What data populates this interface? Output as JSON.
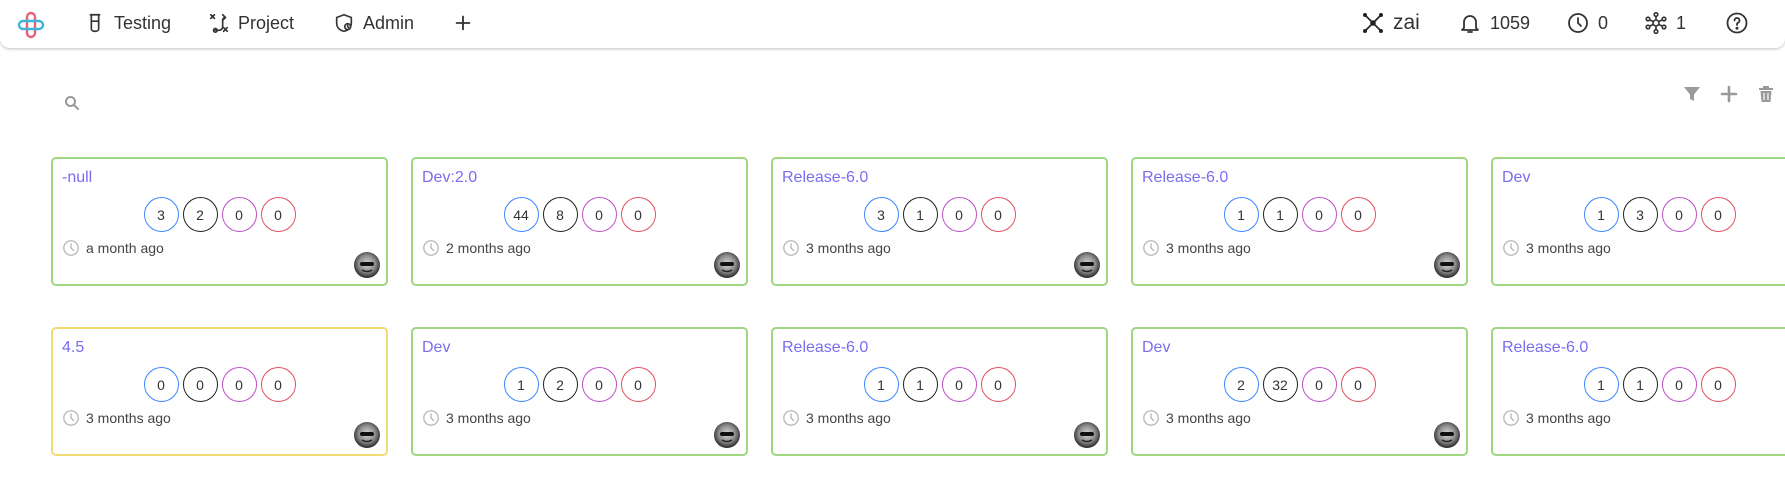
{
  "nav": {
    "testing": "Testing",
    "project": "Project",
    "admin": "Admin"
  },
  "status": {
    "user": "zai",
    "notifications": "1059",
    "pending": "0",
    "network": "1"
  },
  "colors": {
    "accent": "#7b6cf0",
    "card_border_green": "#9fd67f",
    "card_border_yellow": "#f0dc73",
    "count_blue": "#3a86ff",
    "count_dark": "#222222",
    "count_purple": "#c050c8",
    "count_red": "#e05060"
  },
  "icons": {
    "logo": "app-logo-icon",
    "testing": "flask-icon",
    "project": "route-icon",
    "admin": "shield-icon",
    "add": "plus-icon",
    "user": "network-node-icon",
    "notifications": "bell-icon",
    "pending": "clock-icon",
    "network": "hub-icon",
    "help": "help-icon",
    "search": "search-icon",
    "filter": "filter-icon",
    "tool_add": "plus-icon",
    "delete": "trash-icon"
  },
  "cards": [
    {
      "title": "-null",
      "counts": [
        "3",
        "2",
        "0",
        "0"
      ],
      "time": "a month ago",
      "border": "green"
    },
    {
      "title": "Dev:2.0",
      "counts": [
        "44",
        "8",
        "0",
        "0"
      ],
      "time": "2 months ago",
      "border": "green"
    },
    {
      "title": "Release-6.0",
      "counts": [
        "3",
        "1",
        "0",
        "0"
      ],
      "time": "3 months ago",
      "border": "green"
    },
    {
      "title": "Release-6.0",
      "counts": [
        "1",
        "1",
        "0",
        "0"
      ],
      "time": "3 months ago",
      "border": "green"
    },
    {
      "title": "Dev",
      "counts": [
        "1",
        "3",
        "0",
        "0"
      ],
      "time": "3 months ago",
      "border": "green"
    },
    {
      "title": "4.5",
      "counts": [
        "0",
        "0",
        "0",
        "0"
      ],
      "time": "3 months ago",
      "border": "yellow"
    },
    {
      "title": "Dev",
      "counts": [
        "1",
        "2",
        "0",
        "0"
      ],
      "time": "3 months ago",
      "border": "green"
    },
    {
      "title": "Release-6.0",
      "counts": [
        "1",
        "1",
        "0",
        "0"
      ],
      "time": "3 months ago",
      "border": "green"
    },
    {
      "title": "Dev",
      "counts": [
        "2",
        "32",
        "0",
        "0"
      ],
      "time": "3 months ago",
      "border": "green"
    },
    {
      "title": "Release-6.0",
      "counts": [
        "1",
        "1",
        "0",
        "0"
      ],
      "time": "3 months ago",
      "border": "green"
    }
  ]
}
